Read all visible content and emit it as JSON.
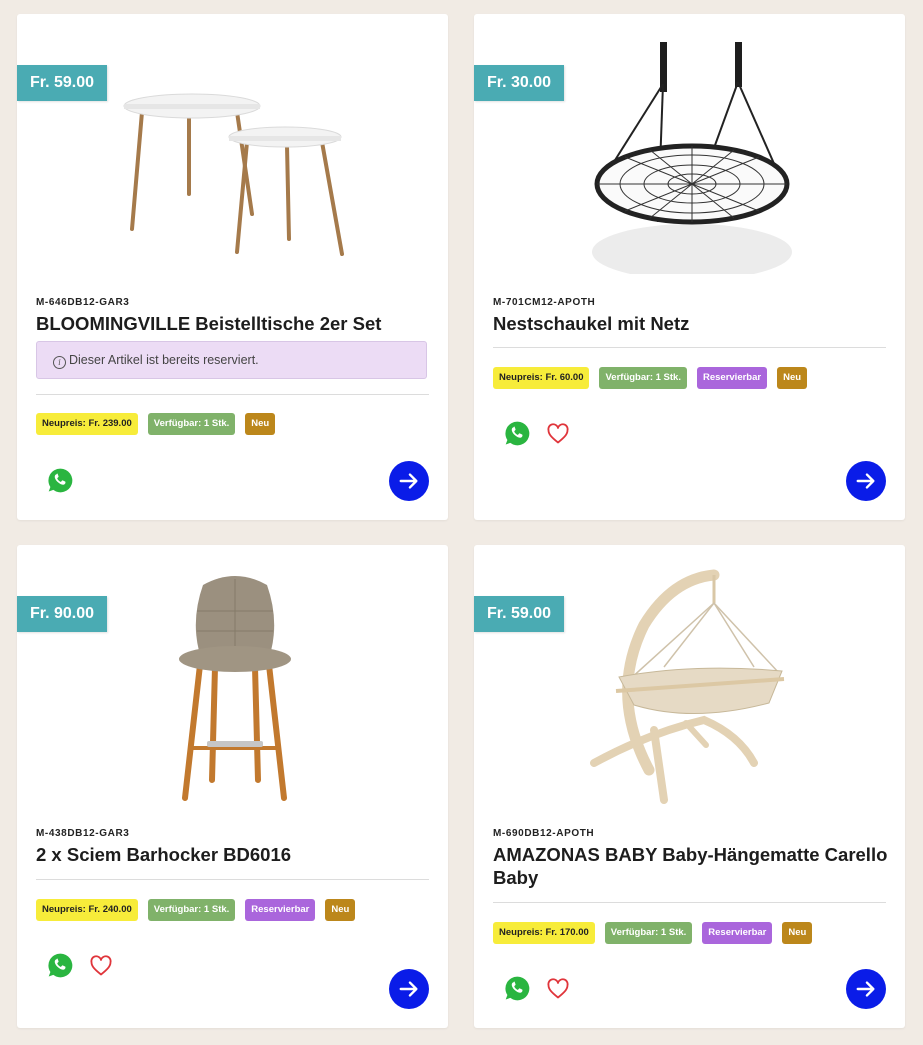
{
  "products": [
    {
      "price": "Fr. 59.00",
      "sku": "M-646DB12-GAR3",
      "title": "BLOOMINGVILLE Beistelltische 2er Set",
      "notice": "Dieser Artikel ist bereits reserviert.",
      "badges": {
        "new_price": "Neupreis: Fr. 239.00",
        "available": "Verfügbar: 1 Stk.",
        "new": "Neu"
      },
      "image": "side-tables-image"
    },
    {
      "price": "Fr. 30.00",
      "sku": "M-701CM12-APOTH",
      "title": "Nestschaukel mit Netz",
      "badges": {
        "new_price": "Neupreis: Fr. 60.00",
        "available": "Verfügbar: 1 Stk.",
        "reservable": "Reservierbar",
        "new": "Neu"
      },
      "image": "nest-swing-image"
    },
    {
      "price": "Fr. 90.00",
      "sku": "M-438DB12-GAR3",
      "title": "2 x Sciem Barhocker BD6016",
      "badges": {
        "new_price": "Neupreis: Fr. 240.00",
        "available": "Verfügbar: 1 Stk.",
        "reservable": "Reservierbar",
        "new": "Neu"
      },
      "image": "bar-stool-image"
    },
    {
      "price": "Fr. 59.00",
      "sku": "M-690DB12-APOTH",
      "title": "AMAZONAS BABY Baby-Hängematte Carello Baby",
      "badges": {
        "new_price": "Neupreis: Fr. 170.00",
        "available": "Verfügbar: 1 Stk.",
        "reservable": "Reservierbar",
        "new": "Neu"
      },
      "image": "baby-hammock-image"
    }
  ],
  "icons": {
    "whatsapp": "whatsapp-icon",
    "favorite": "heart-icon",
    "open": "arrow-right-icon"
  },
  "colors": {
    "page_background": "#f1ebe4",
    "price_tag": "#4aabb3",
    "new_price_badge": "#f7ec3a",
    "available_badge": "#80b26a",
    "reservable_badge": "#aa66dc",
    "new_badge": "#bc871b",
    "open_button": "#0a1ce8",
    "reserved_notice": "#ecdcf5"
  }
}
